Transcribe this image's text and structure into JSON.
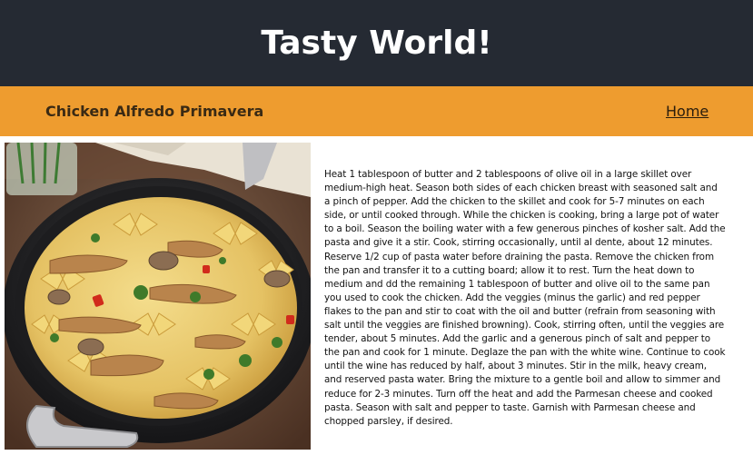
{
  "site": {
    "title": "Tasty World!"
  },
  "nav": {
    "recipe_name": "Chicken Alfredo Primavera",
    "home_label": "Home"
  },
  "recipe": {
    "image_subject": "chicken alfredo primavera in a skillet",
    "instructions": "Heat 1 tablespoon of butter and 2 tablespoons of olive oil in a large skillet over medium-high heat. Season both sides of each chicken breast with seasoned salt and a pinch of pepper. Add the chicken to the skillet and cook for 5-7 minutes on each side, or until cooked through. While the chicken is cooking, bring a large pot of water to a boil. Season the boiling water with a few generous pinches of kosher salt. Add the pasta and give it a stir. Cook, stirring occasionally, until al dente, about 12 minutes. Reserve 1/2 cup of pasta water before draining the pasta. Remove the chicken from the pan and transfer it to a cutting board; allow it to rest. Turn the heat down to medium and dd the remaining 1 tablespoon of butter and olive oil to the same pan you used to cook the chicken. Add the veggies (minus the garlic) and red pepper flakes to the pan and stir to coat with the oil and butter (refrain from seasoning with salt until the veggies are finished browning). Cook, stirring often, until the veggies are tender, about 5 minutes. Add the garlic and a generous pinch of salt and pepper to the pan and cook for 1 minute. Deglaze the pan with the white wine. Continue to cook until the wine has reduced by half, about 3 minutes. Stir in the milk, heavy cream, and reserved pasta water. Bring the mixture to a gentle boil and allow to simmer and reduce for 2-3 minutes. Turn off the heat and add the Parmesan cheese and cooked pasta. Season with salt and pepper to taste. Garnish with Parmesan cheese and chopped parsley, if desired."
  },
  "colors": {
    "header_bg": "#252a33",
    "nav_bg": "#ee9c2f",
    "page_bg": "#ffffff"
  }
}
